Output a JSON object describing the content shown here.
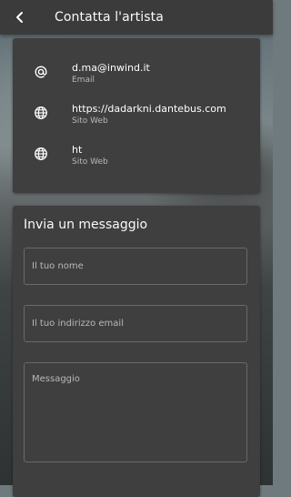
{
  "header": {
    "title": "Contatta l'artista"
  },
  "contacts": [
    {
      "icon": "at-icon",
      "value": "d.ma@inwind.it",
      "label": "Email"
    },
    {
      "icon": "globe-icon",
      "value": "https://dadarkni.dantebus.com",
      "label": "Sito Web"
    },
    {
      "icon": "globe-icon",
      "value": "ht",
      "label": "Sito Web"
    }
  ],
  "form": {
    "heading": "Invia un messaggio",
    "name_placeholder": "Il tuo nome",
    "email_placeholder": "Il tuo indirizzo email",
    "message_placeholder": "Messaggio"
  }
}
